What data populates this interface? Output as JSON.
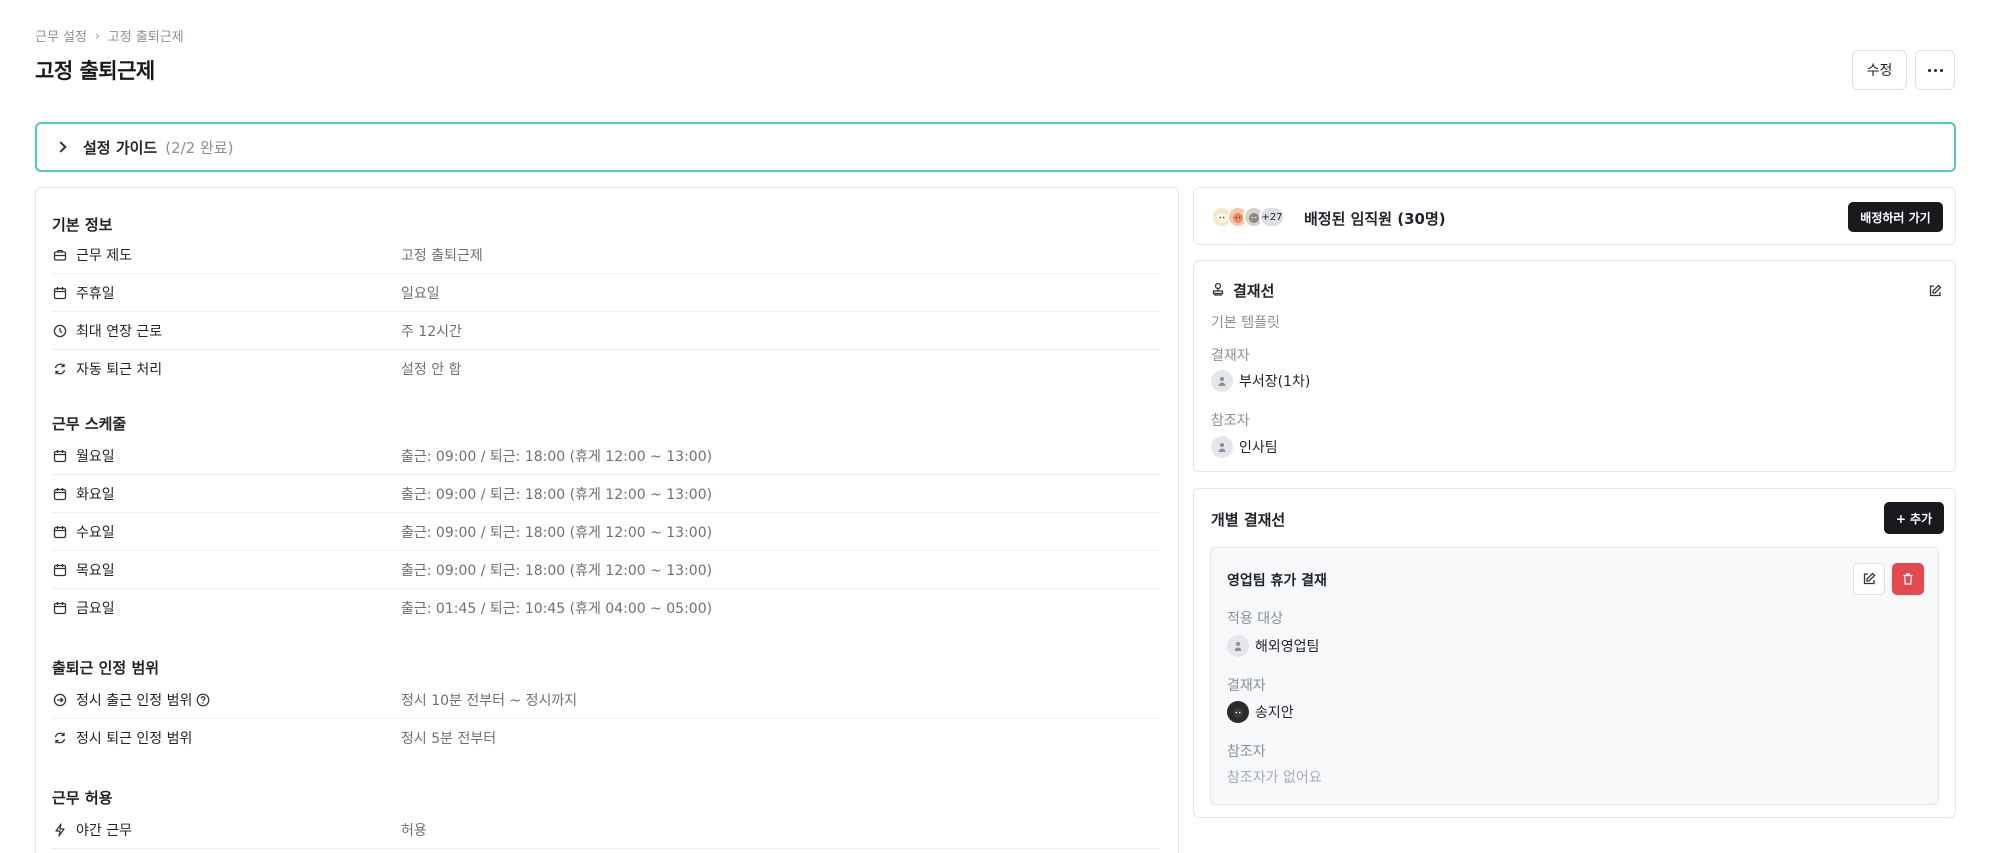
{
  "breadcrumb": {
    "parent": "근무 설정",
    "current": "고정 출퇴근제"
  },
  "page_title": "고정 출퇴근제",
  "header_actions": {
    "edit_label": "수정"
  },
  "guide": {
    "title": "설정 가이드",
    "progress": "(2/2 완료)"
  },
  "basic_info": {
    "title": "기본 정보",
    "rows": [
      {
        "label": "근무 제도",
        "value": "고정 출퇴근제",
        "icon": "briefcase-icon"
      },
      {
        "label": "주휴일",
        "value": "일요일",
        "icon": "calendar-icon"
      },
      {
        "label": "최대 연장 근로",
        "value": "주 12시간",
        "icon": "clock-icon"
      },
      {
        "label": "자동 퇴근 처리",
        "value": "설정 안 함",
        "icon": "refresh-icon"
      }
    ]
  },
  "schedule": {
    "title": "근무 스케줄",
    "rows": [
      {
        "label": "월요일",
        "value": "출근: 09:00 / 퇴근: 18:00 (휴게 12:00 ~ 13:00)"
      },
      {
        "label": "화요일",
        "value": "출근: 09:00 / 퇴근: 18:00 (휴게 12:00 ~ 13:00)"
      },
      {
        "label": "수요일",
        "value": "출근: 09:00 / 퇴근: 18:00 (휴게 12:00 ~ 13:00)"
      },
      {
        "label": "목요일",
        "value": "출근: 09:00 / 퇴근: 18:00 (휴게 12:00 ~ 13:00)"
      },
      {
        "label": "금요일",
        "value": "출근: 01:45 / 퇴근: 10:45 (휴게 04:00 ~ 05:00)"
      }
    ]
  },
  "attendance_range": {
    "title": "출퇴근 인정 범위",
    "rows": [
      {
        "label": "정시 출근 인정 범위",
        "value": "정시 10분 전부터 ~ 정시까지"
      },
      {
        "label": "정시 퇴근 인정 범위",
        "value": "정시 5분 전부터"
      }
    ]
  },
  "work_allow": {
    "title": "근무 허용",
    "rows": [
      {
        "label": "야간 근무",
        "value": "허용"
      }
    ]
  },
  "assigned": {
    "more_count": "+27",
    "title": "배정된 임직원 (30명)",
    "button": "배정하러 가기"
  },
  "approval": {
    "title": "결재선",
    "template": "기본 템플릿",
    "approver_label": "결재자",
    "approver": "부서장(1차)",
    "reference_label": "참조자",
    "reference": "인사팀"
  },
  "individual": {
    "title": "개별 결재선",
    "add_button": "+ 추가",
    "item": {
      "title": "영업팀 휴가 결재",
      "target_label": "적용 대상",
      "target": "해외영업팀",
      "approver_label": "결재자",
      "approver": "송지안",
      "reference_label": "참조자",
      "reference_empty": "참조자가 없어요"
    }
  },
  "colors": {
    "accent_border": "#4cc9c0",
    "dark_button": "#17191c",
    "delete_button": "#e5484d"
  }
}
